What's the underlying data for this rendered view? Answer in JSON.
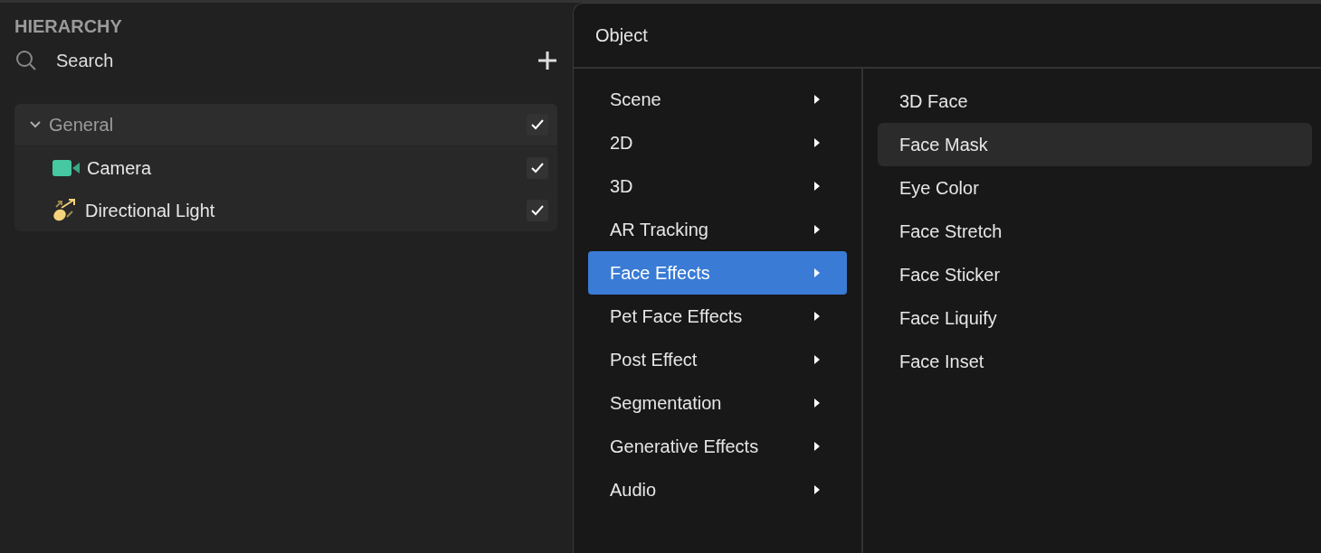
{
  "hierarchy": {
    "title": "HIERARCHY",
    "search": {
      "placeholder": "Search"
    },
    "groups": [
      {
        "label": "General",
        "expanded": true,
        "checked": true,
        "children": [
          {
            "label": "Camera",
            "kind": "camera",
            "checked": true
          },
          {
            "label": "Directional Light",
            "kind": "light",
            "checked": true
          }
        ]
      }
    ]
  },
  "menu": {
    "title": "Object",
    "categories": [
      {
        "label": "Scene",
        "selected": false
      },
      {
        "label": "2D",
        "selected": false
      },
      {
        "label": "3D",
        "selected": false
      },
      {
        "label": "AR Tracking",
        "selected": false
      },
      {
        "label": "Face Effects",
        "selected": true
      },
      {
        "label": "Pet Face Effects",
        "selected": false
      },
      {
        "label": "Post Effect",
        "selected": false
      },
      {
        "label": "Segmentation",
        "selected": false
      },
      {
        "label": "Generative Effects",
        "selected": false
      },
      {
        "label": "Audio",
        "selected": false
      }
    ],
    "items": [
      {
        "label": "3D Face",
        "highlighted": false
      },
      {
        "label": "Face Mask",
        "highlighted": true
      },
      {
        "label": "Eye Color",
        "highlighted": false
      },
      {
        "label": "Face Stretch",
        "highlighted": false
      },
      {
        "label": "Face Sticker",
        "highlighted": false
      },
      {
        "label": "Face Liquify",
        "highlighted": false
      },
      {
        "label": "Face Inset",
        "highlighted": false
      }
    ]
  }
}
